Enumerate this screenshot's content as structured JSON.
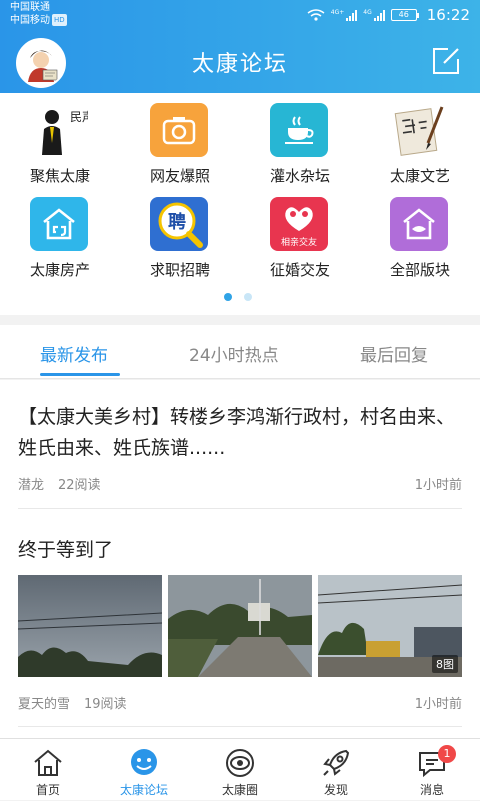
{
  "status_bar": {
    "carrier1": "中国联通",
    "carrier2": "中国移动",
    "carrier2_tag": "HD",
    "signal1_tag": "4G+",
    "signal2_tag": "4G",
    "battery": "46",
    "time": "16:22"
  },
  "header": {
    "title": "太康论坛",
    "avatar_icon": "avatar-cartoon-icon",
    "edit_icon": "compose-icon"
  },
  "categories": [
    {
      "label": "聚焦太康",
      "icon": "news-figure-icon",
      "icon_text": "民声"
    },
    {
      "label": "网友爆照",
      "icon": "camera-icon",
      "color": "#f7a33c"
    },
    {
      "label": "灌水杂坛",
      "icon": "coffee-cup-icon",
      "color": "#27b6d4"
    },
    {
      "label": "太康文艺",
      "icon": "calligraphy-icon"
    },
    {
      "label": "太康房产",
      "icon": "house-icon",
      "color": "#2fb6ea"
    },
    {
      "label": "求职招聘",
      "icon": "recruit-icon",
      "color": "#2f6fd1",
      "icon_text": "聘"
    },
    {
      "label": "征婚交友",
      "icon": "couple-heart-icon",
      "color": "#e8354f",
      "icon_text": "相亲交友"
    },
    {
      "label": "全部版块",
      "icon": "all-sections-icon",
      "color": "#b06dd9"
    }
  ],
  "pager": {
    "pages": 2,
    "active": 0
  },
  "tabs": [
    {
      "label": "最新发布",
      "active": true
    },
    {
      "label": "24小时热点",
      "active": false
    },
    {
      "label": "最后回复",
      "active": false
    }
  ],
  "posts": [
    {
      "title": "【太康大美乡村】转楼乡李鸿渐行政村，村名由来、姓氏由来、姓氏族谱......",
      "author": "潜龙",
      "reads": "22阅读",
      "time": "1小时前"
    },
    {
      "title": "终于等到了",
      "author": "夏天的雪",
      "reads": "19阅读",
      "time": "1小时前",
      "photo_count": "8图"
    }
  ],
  "bottom_nav": [
    {
      "label": "首页",
      "icon": "home-icon",
      "active": false
    },
    {
      "label": "太康论坛",
      "icon": "forum-icon",
      "active": true
    },
    {
      "label": "太康圈",
      "icon": "circle-eye-icon",
      "active": false
    },
    {
      "label": "发现",
      "icon": "rocket-icon",
      "active": false
    },
    {
      "label": "消息",
      "icon": "message-icon",
      "active": false,
      "badge": "1"
    }
  ],
  "colors": {
    "accent": "#2a95e8",
    "badge": "#f04848"
  }
}
